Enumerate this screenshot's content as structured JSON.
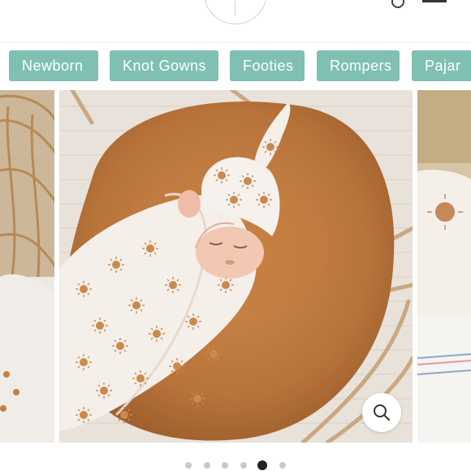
{
  "categories": [
    {
      "label": "Newborn"
    },
    {
      "label": "Knot Gowns"
    },
    {
      "label": "Footies"
    },
    {
      "label": "Rompers"
    },
    {
      "label": "Pajar"
    }
  ],
  "carousel": {
    "slide_count": 6,
    "active_index": 4,
    "icons": {
      "zoom": "magnifier-icon"
    }
  },
  "colors": {
    "accent": "#7fc0b2",
    "dot_active": "#222222",
    "dot_inactive": "#c9c9c9"
  }
}
